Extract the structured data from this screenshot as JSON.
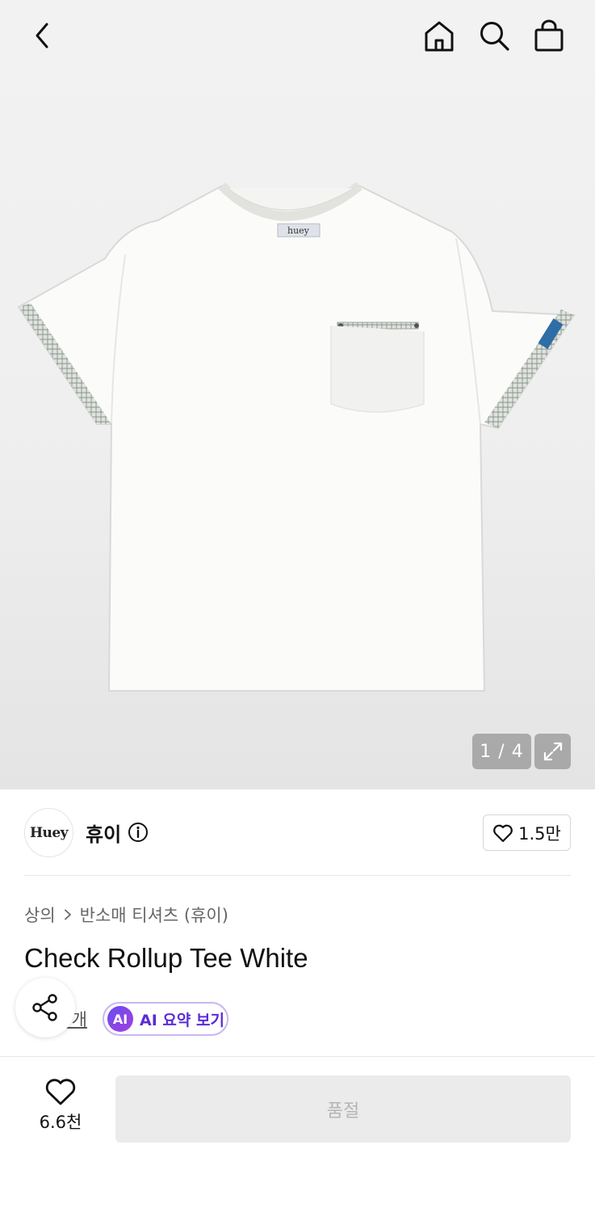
{
  "topbar": {
    "back_icon": "chevron-left-icon",
    "home_icon": "home-icon",
    "search_icon": "search-icon",
    "cart_icon": "shopping-bag-icon"
  },
  "gallery": {
    "counter": "1 / 4",
    "expand_icon": "expand-icon"
  },
  "brand": {
    "logo_text": "Huey",
    "name": "휴이",
    "info_icon": "info-icon",
    "follow_count": "1.5만"
  },
  "breadcrumb": {
    "items": [
      "상의",
      "반소매 티셔츠 (휴이)"
    ]
  },
  "product": {
    "title": "Check Rollup Tee White"
  },
  "reviews": {
    "count_label": "리뷰 6개",
    "ai_badge": "AI",
    "ai_label": "AI 요약 보기"
  },
  "bottom_bar": {
    "like_count": "6.6천",
    "soldout_label": "품절"
  },
  "colors": {
    "accent": "#5b2bd6",
    "ai_border": "#c9b6f2",
    "soldout_bg": "#ebebeb"
  }
}
